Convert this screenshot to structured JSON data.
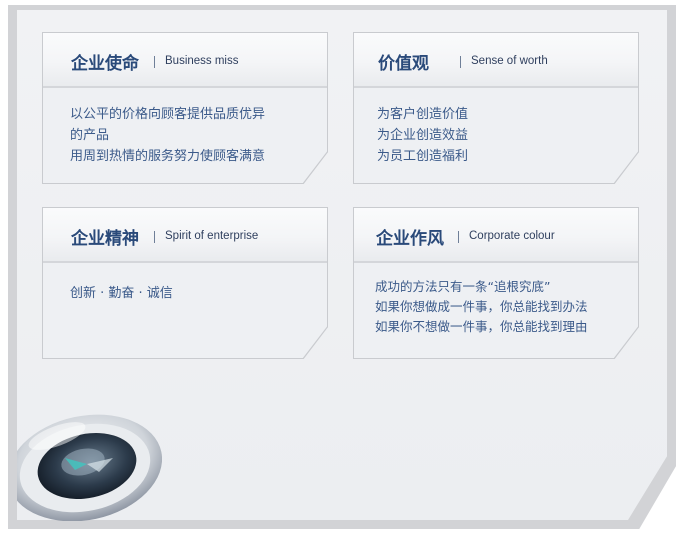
{
  "cards": [
    {
      "title_cn": "企业使命",
      "title_en": "Business miss",
      "lines": [
        "以公平的价格向顾客提供品质优异",
        "的产品",
        "用周到热情的服务努力使顾客满意"
      ]
    },
    {
      "title_cn": "价值观",
      "title_en": "Sense of worth",
      "lines": [
        "为客户创造价值",
        "为企业创造效益",
        "为员工创造福利"
      ]
    },
    {
      "title_cn": "企业精神",
      "title_en": "Spirit of enterprise",
      "lines": [
        "创新 · 勤奋 · 诚信"
      ]
    },
    {
      "title_cn": "企业作风",
      "title_en": "Corporate colour",
      "lines": [
        "成功的方法只有一条“追根究底”",
        "如果你想做成一件事，你总能找到办法",
        "如果你不想做一件事，你总能找到理由"
      ]
    }
  ],
  "decoration": {
    "image": "compass-icon",
    "accent_color": "#2a4a7a",
    "text_color": "#3b5a8a"
  }
}
